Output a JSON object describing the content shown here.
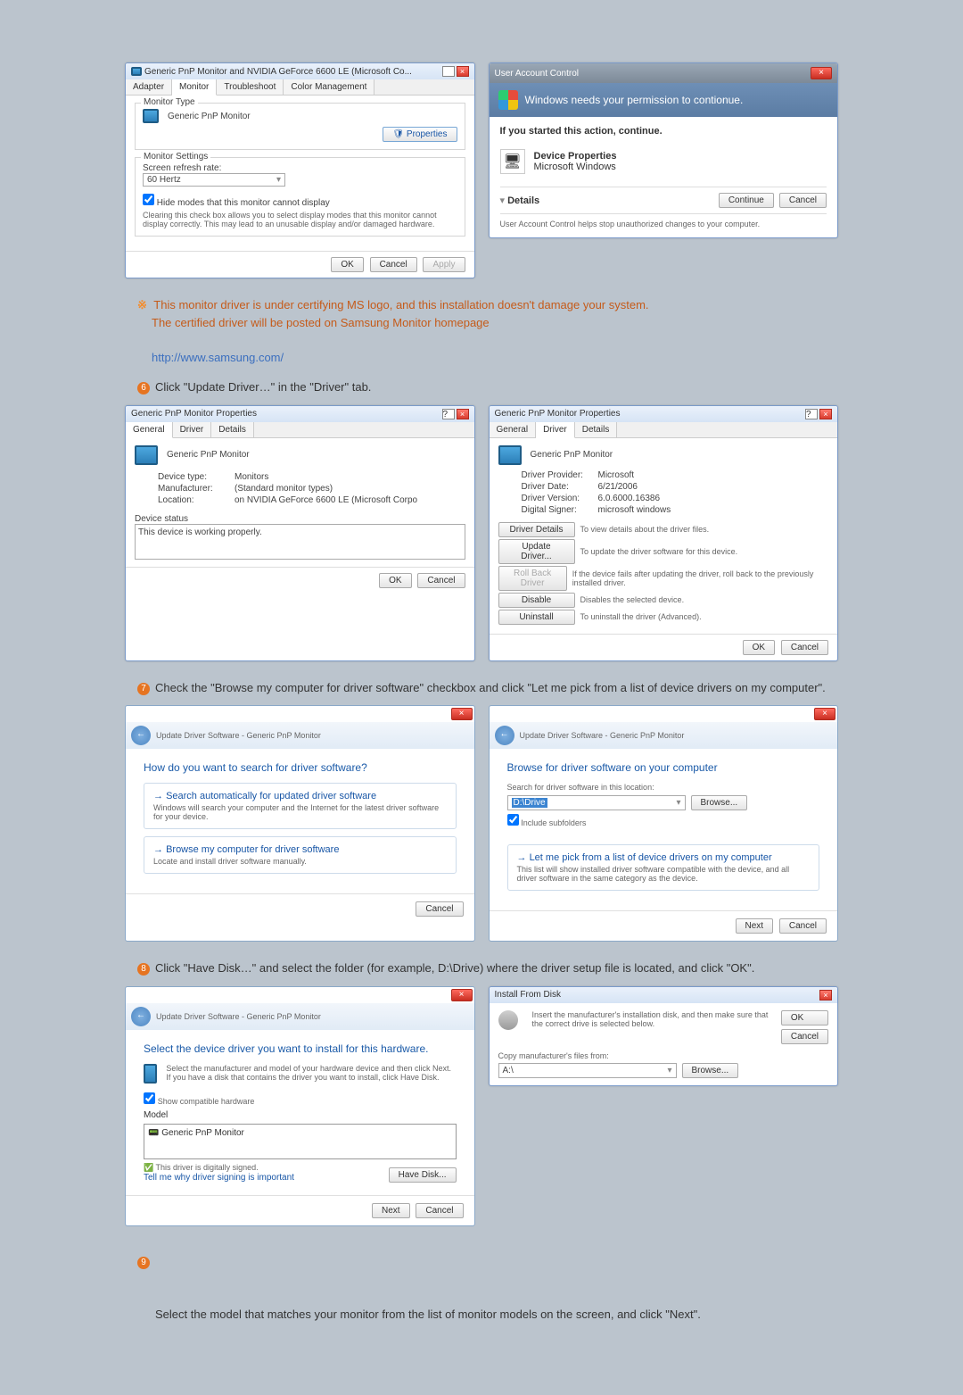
{
  "monitorDialog": {
    "title": "Generic PnP Monitor and NVIDIA GeForce 6600 LE (Microsoft Co...",
    "tabs": [
      "Adapter",
      "Monitor",
      "Troubleshoot",
      "Color Management"
    ],
    "monitorTypeLabel": "Monitor Type",
    "monitorTypeValue": "Generic PnP Monitor",
    "propertiesBtn": "Properties",
    "monitorSettingsLabel": "Monitor Settings",
    "refreshLabel": "Screen refresh rate:",
    "refreshValue": "60 Hertz",
    "hideCheckbox": "Hide modes that this monitor cannot display",
    "hideDesc": "Clearing this check box allows you to select display modes that this monitor cannot display correctly. This may lead to an unusable display and/or damaged hardware.",
    "ok": "OK",
    "cancel": "Cancel",
    "apply": "Apply"
  },
  "uac": {
    "title": "User Account Control",
    "heading": "Windows needs your permission to contionue.",
    "started": "If you started this action, continue.",
    "progName": "Device Properties",
    "progVendor": "Microsoft Windows",
    "details": "Details",
    "continue": "Continue",
    "cancel": "Cancel",
    "footer": "User Account Control helps stop unauthorized changes to your computer."
  },
  "note5": {
    "asterisk": "※",
    "line1": "This monitor driver is under certifying MS logo, and this installation doesn't damage your system.",
    "line2": "The certified driver will be posted on Samsung Monitor homepage",
    "link": "http://www.samsung.com/"
  },
  "step6": {
    "num": "6",
    "text": "Click \"Update Driver…\" in the \"Driver\" tab."
  },
  "propsGeneral": {
    "title": "Generic PnP Monitor Properties",
    "tabs": [
      "General",
      "Driver",
      "Details"
    ],
    "name": "Generic PnP Monitor",
    "deviceTypeLabel": "Device type:",
    "deviceType": "Monitors",
    "mfLabel": "Manufacturer:",
    "mf": "(Standard monitor types)",
    "locLabel": "Location:",
    "loc": "on NVIDIA GeForce 6600 LE (Microsoft Corpo",
    "statusLabel": "Device status",
    "status": "This device is working properly.",
    "ok": "OK",
    "cancel": "Cancel"
  },
  "propsDriver": {
    "title": "Generic PnP Monitor Properties",
    "tabs": [
      "General",
      "Driver",
      "Details"
    ],
    "name": "Generic PnP Monitor",
    "providerLabel": "Driver Provider:",
    "provider": "Microsoft",
    "dateLabel": "Driver Date:",
    "date": "6/21/2006",
    "verLabel": "Driver Version:",
    "ver": "6.0.6000.16386",
    "signerLabel": "Digital Signer:",
    "signer": "microsoft windows",
    "btnDetails": "Driver Details",
    "txtDetails": "To view details about the driver files.",
    "btnUpdate": "Update Driver...",
    "txtUpdate": "To update the driver software for this device.",
    "btnRoll": "Roll Back Driver",
    "txtRoll": "If the device fails after updating the driver, roll back to the previously installed driver.",
    "btnDisable": "Disable",
    "txtDisable": "Disables the selected device.",
    "btnUninstall": "Uninstall",
    "txtUninstall": "To uninstall the driver (Advanced).",
    "ok": "OK",
    "cancel": "Cancel"
  },
  "step7": {
    "num": "7",
    "text": "Check the \"Browse my computer for driver software\" checkbox and click \"Let me pick from a list of device drivers on my computer\"."
  },
  "wizSearch": {
    "crumb": "Update Driver Software - Generic PnP Monitor",
    "title": "How do you want to search for driver software?",
    "opt1t": "Search automatically for updated driver software",
    "opt1d": "Windows will search your computer and the Internet for the latest driver software for your device.",
    "opt2t": "Browse my computer for driver software",
    "opt2d": "Locate and install driver software manually.",
    "cancel": "Cancel"
  },
  "wizBrowse": {
    "crumb": "Update Driver Software - Generic PnP Monitor",
    "title": "Browse for driver software on your computer",
    "searchLabel": "Search for driver software in this location:",
    "path": "D:\\Drive",
    "browse": "Browse...",
    "include": "Include subfolders",
    "pickt": "Let me pick from a list of device drivers on my computer",
    "pickd": "This list will show installed driver software compatible with the device, and all driver software in the same category as the device.",
    "next": "Next",
    "cancel": "Cancel"
  },
  "step8": {
    "num": "8",
    "text": "Click \"Have Disk…\" and select the folder (for example, D:\\Drive) where the driver setup file is located, and click \"OK\"."
  },
  "wizSelect": {
    "crumb": "Update Driver Software - Generic PnP Monitor",
    "title": "Select the device driver you want to install for this hardware.",
    "desc": "Select the manufacturer and model of your hardware device and then click Next. If you have a disk that contains the driver you want to install, click Have Disk.",
    "showCompat": "Show compatible hardware",
    "modelHead": "Model",
    "modelItem": "Generic PnP Monitor",
    "signed": "This driver is digitally signed.",
    "tellme": "Tell me why driver signing is important",
    "haveDisk": "Have Disk...",
    "next": "Next",
    "cancel": "Cancel"
  },
  "installDisk": {
    "title": "Install From Disk",
    "desc": "Insert the manufacturer's installation disk, and then make sure that the correct drive is selected below.",
    "ok": "OK",
    "cancel": "Cancel",
    "copyLabel": "Copy manufacturer's files from:",
    "path": "A:\\",
    "browse": "Browse..."
  },
  "step9": {
    "num": "9",
    "text": "Select the model that matches your monitor from the list of monitor models on the screen, and click \"Next\"."
  }
}
